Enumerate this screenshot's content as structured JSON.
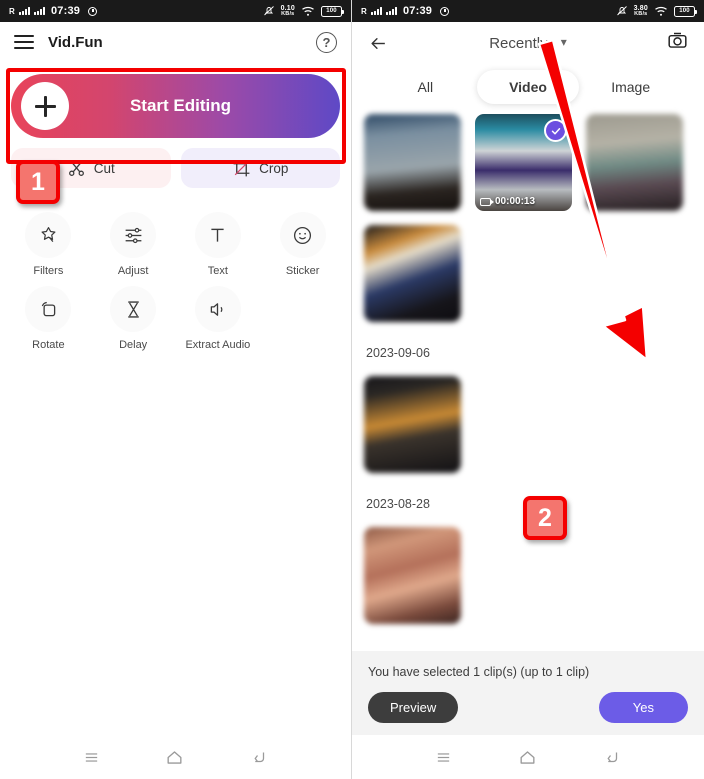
{
  "left": {
    "status": {
      "carrier": "R",
      "time": "07:39",
      "net_value": "0.10",
      "net_unit": "KB/s",
      "battery": "100"
    },
    "header": {
      "menu_icon": "hamburger-icon",
      "title": "Vid.Fun",
      "help_icon": "help-circle-icon"
    },
    "start_button": {
      "label": "Start Editing",
      "plus_icon": "plus-icon"
    },
    "tabs": [
      {
        "label": "Cut",
        "icon": "cut-icon"
      },
      {
        "label": "Crop",
        "icon": "crop-icon"
      }
    ],
    "tools": [
      {
        "label": "Filters",
        "icon": "filters-icon"
      },
      {
        "label": "Adjust",
        "icon": "adjust-icon"
      },
      {
        "label": "Text",
        "icon": "text-icon"
      },
      {
        "label": "Sticker",
        "icon": "sticker-icon"
      },
      {
        "label": "Rotate",
        "icon": "rotate-icon"
      },
      {
        "label": "Delay",
        "icon": "delay-icon"
      },
      {
        "label": "Extract\nAudio",
        "icon": "extract-audio-icon"
      }
    ]
  },
  "right": {
    "status": {
      "carrier": "R",
      "time": "07:39",
      "net_value": "3.80",
      "net_unit": "KB/s",
      "battery": "100"
    },
    "header": {
      "back_icon": "back-arrow-icon",
      "title": "Recently",
      "chevron": "⌄",
      "camera_icon": "camera-icon"
    },
    "segments": [
      {
        "label": "All",
        "selected": false
      },
      {
        "label": "Video",
        "selected": true
      },
      {
        "label": "Image",
        "selected": false
      }
    ],
    "grid": {
      "items": [
        {
          "duration": "",
          "selected": false
        },
        {
          "duration": "00:00:13",
          "selected": true
        },
        {
          "duration": "",
          "selected": false
        },
        {
          "duration": "",
          "selected": false
        }
      ],
      "sections": [
        {
          "date": "2023-09-06"
        },
        {
          "date": "2023-08-28"
        }
      ]
    },
    "sheet": {
      "message": "You have selected 1 clip(s) (up to 1 clip)",
      "preview_label": "Preview",
      "yes_label": "Yes"
    }
  },
  "annotations": {
    "badge1": "1",
    "badge2": "2",
    "highlight_color": "#f40000",
    "badge_fill": "#f4756e"
  },
  "navbar": {
    "recents_icon": "recents-icon",
    "home_icon": "home-icon",
    "back_icon": "back-icon"
  }
}
